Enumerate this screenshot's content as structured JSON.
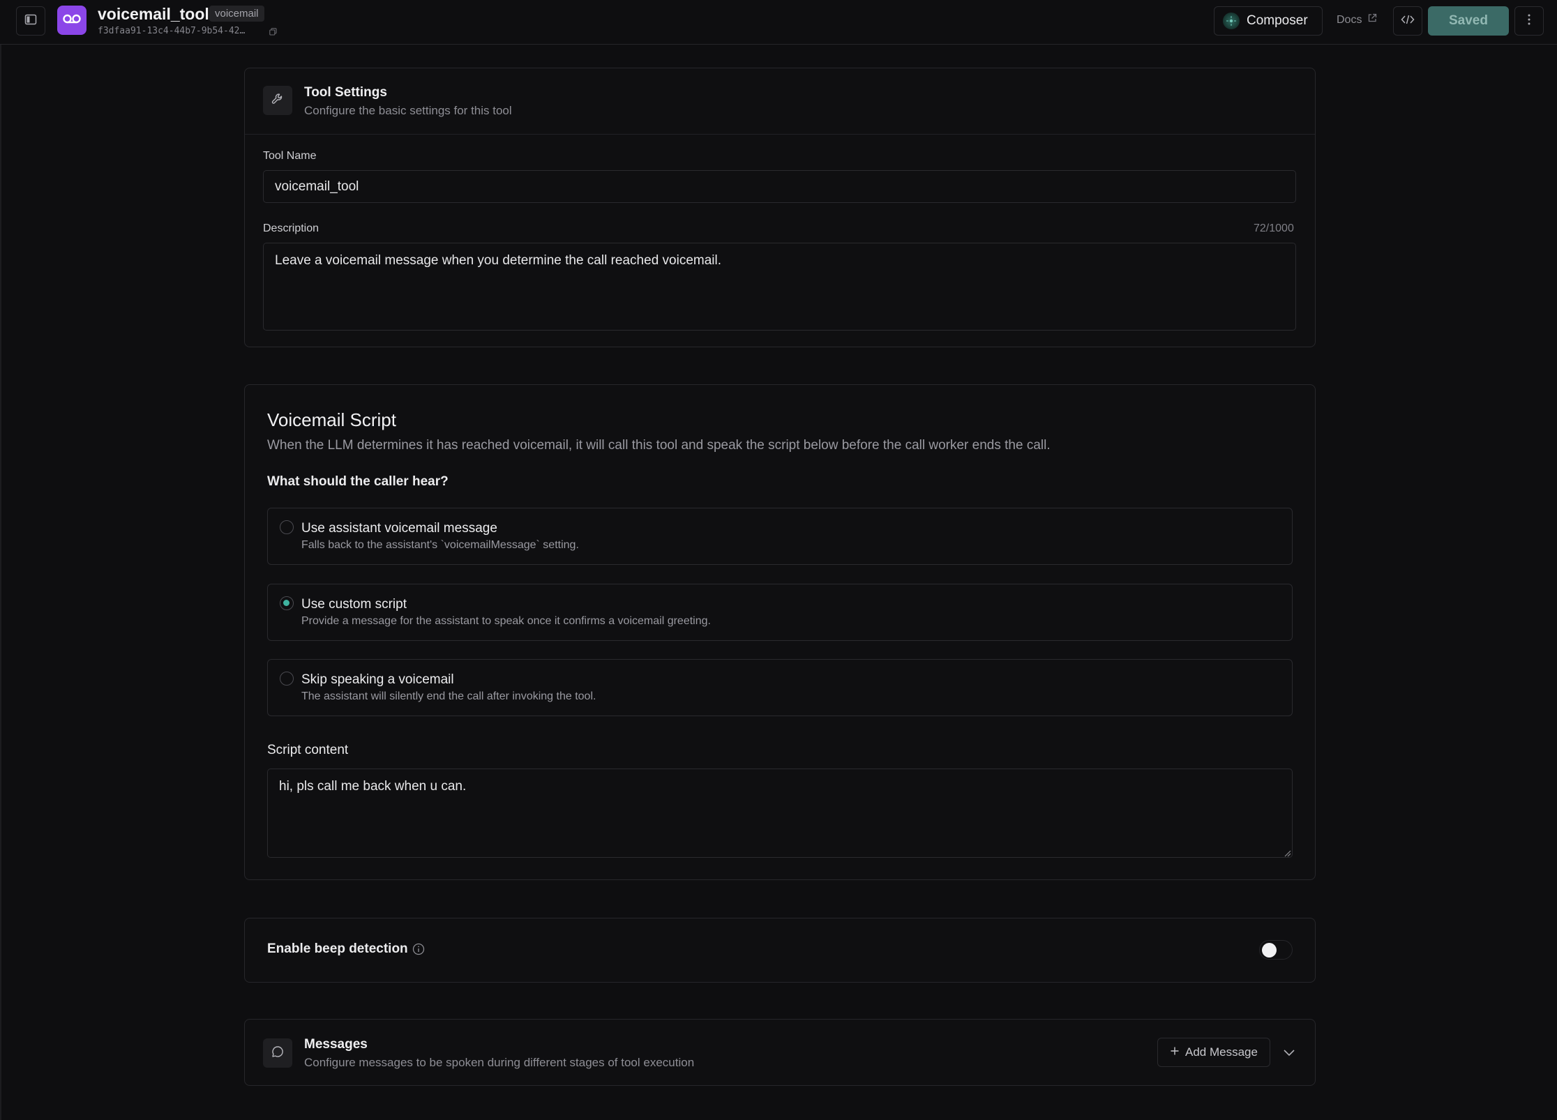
{
  "topbar": {
    "tool_name": "voicemail_tool",
    "tool_type_badge": "voicemail",
    "tool_id": "f3dfaa91-13c4-44b7-9b54-42…",
    "composer_label": "Composer",
    "docs_label": "Docs",
    "saved_label": "Saved",
    "icons": [
      "sidebar-toggle-icon",
      "voicemail-icon",
      "copy-icon",
      "composer-icon",
      "external-link-icon",
      "code-icon",
      "more-vertical-icon"
    ]
  },
  "tool_settings": {
    "title": "Tool Settings",
    "subtitle": "Configure the basic settings for this tool",
    "name_label": "Tool Name",
    "name_value": "voicemail_tool",
    "description_label": "Description",
    "description_count": "72/1000",
    "description_value": "Leave a voicemail message when you determine the call reached voicemail."
  },
  "voicemail_script": {
    "title": "Voicemail Script",
    "description": "When the LLM determines it has reached voicemail, it will call this tool and speak the script below before the call worker ends the call.",
    "question": "What should the caller hear?",
    "options": [
      {
        "title": "Use assistant voicemail message",
        "description": "Falls back to the assistant's `voicemailMessage` setting.",
        "selected": false
      },
      {
        "title": "Use custom script",
        "description": "Provide a message for the assistant to speak once it confirms a voicemail greeting.",
        "selected": true
      },
      {
        "title": "Skip speaking a voicemail",
        "description": "The assistant will silently end the call after invoking the tool.",
        "selected": false
      }
    ],
    "script_label": "Script content",
    "script_value": "hi, pls call me back when u can."
  },
  "beep_detection": {
    "label": "Enable beep detection",
    "enabled": false
  },
  "messages": {
    "title": "Messages",
    "subtitle": "Configure messages to be spoken during different stages of tool execution",
    "add_label": "Add Message"
  },
  "colors": {
    "accent": "#3fb3a0",
    "brand_icon": "#8b46e8",
    "saved_button": "#3b6a66",
    "background": "#0e0e10"
  }
}
